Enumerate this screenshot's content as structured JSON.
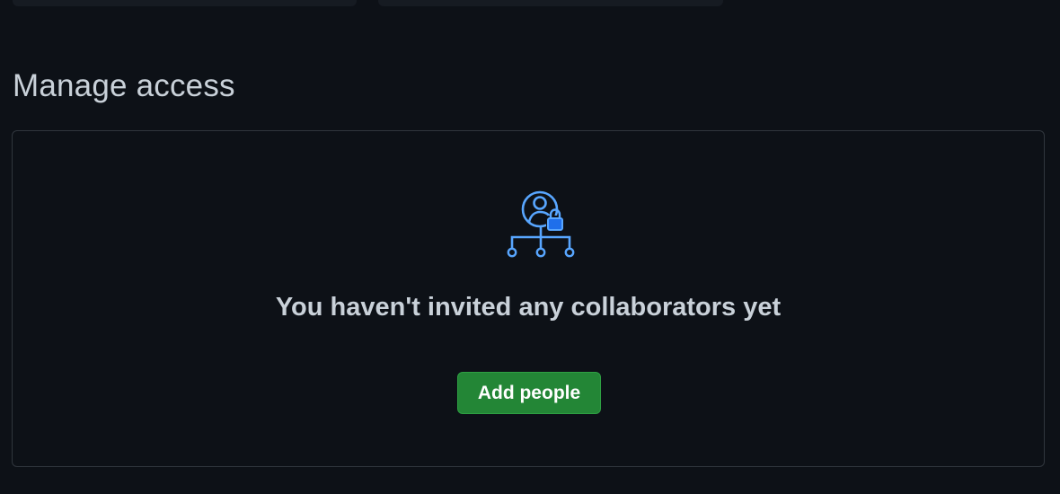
{
  "section": {
    "title": "Manage access"
  },
  "empty_state": {
    "icon": "person-lock-network-icon",
    "heading": "You haven't invited any collaborators yet",
    "button_label": "Add people"
  },
  "colors": {
    "background": "#0d1117",
    "card": "#161b22",
    "border": "#30363d",
    "icon_blue": "#58a6ff",
    "accent_blue": "#1f6feb",
    "button_green": "#238636",
    "text": "#c9d1d9"
  }
}
